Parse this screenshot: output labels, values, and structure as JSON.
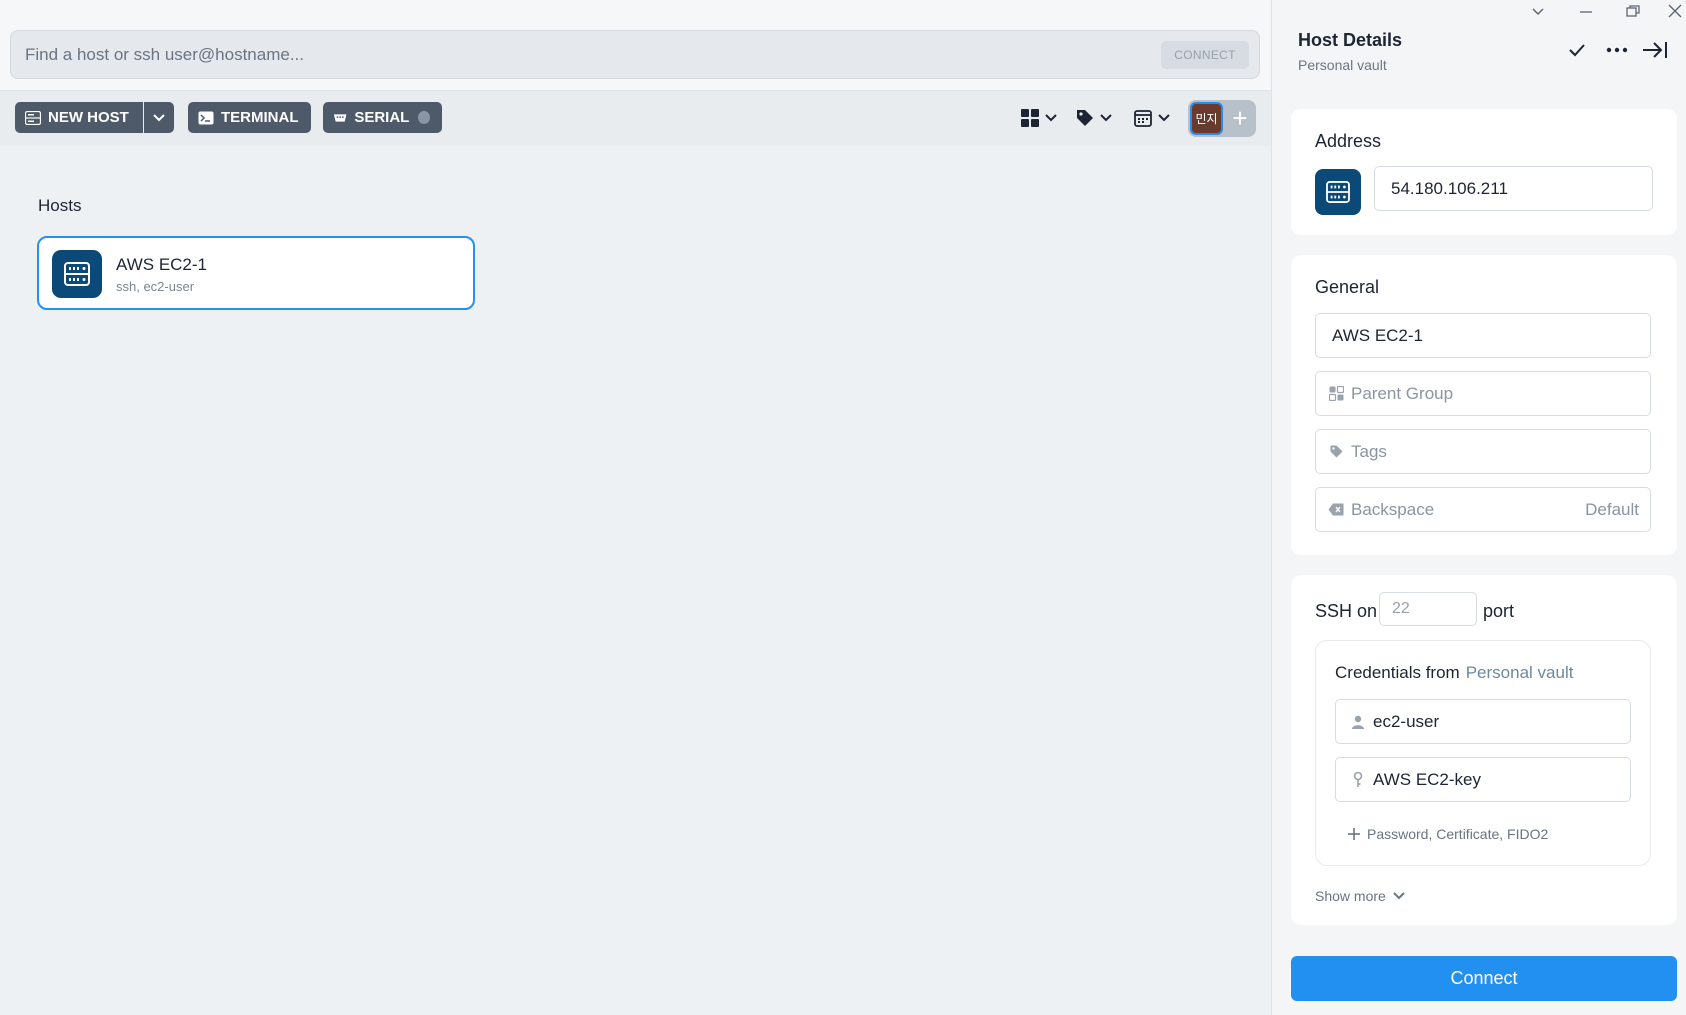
{
  "search": {
    "placeholder": "Find a host or ssh user@hostname...",
    "connect_label": "CONNECT"
  },
  "toolbar": {
    "new_host_label": "NEW HOST",
    "terminal_label": "TERMINAL",
    "serial_label": "SERIAL"
  },
  "avatar": {
    "initials": "민지"
  },
  "hosts": {
    "title": "Hosts",
    "items": [
      {
        "name": "AWS EC2-1",
        "subtitle": "ssh, ec2-user"
      }
    ]
  },
  "panel": {
    "title": "Host Details",
    "subtitle": "Personal vault",
    "address": {
      "label": "Address",
      "value": "54.180.106.211"
    },
    "general": {
      "label": "General",
      "name_value": "AWS EC2-1",
      "parent_group_placeholder": "Parent Group",
      "tags_placeholder": "Tags",
      "backspace_label": "Backspace",
      "backspace_value": "Default"
    },
    "ssh": {
      "prefix": "SSH on",
      "port_placeholder": "22",
      "suffix": "port",
      "credentials_label": "Credentials from",
      "credentials_vault": "Personal vault",
      "username": "ec2-user",
      "key": "AWS EC2-key",
      "add_label": "Password, Certificate, FIDO2",
      "show_more": "Show more"
    },
    "connect_label": "Connect"
  },
  "colors": {
    "accent": "#2190f0",
    "host_icon_bg": "#0b4a78",
    "toolbar_button": "#4e5a6a"
  }
}
